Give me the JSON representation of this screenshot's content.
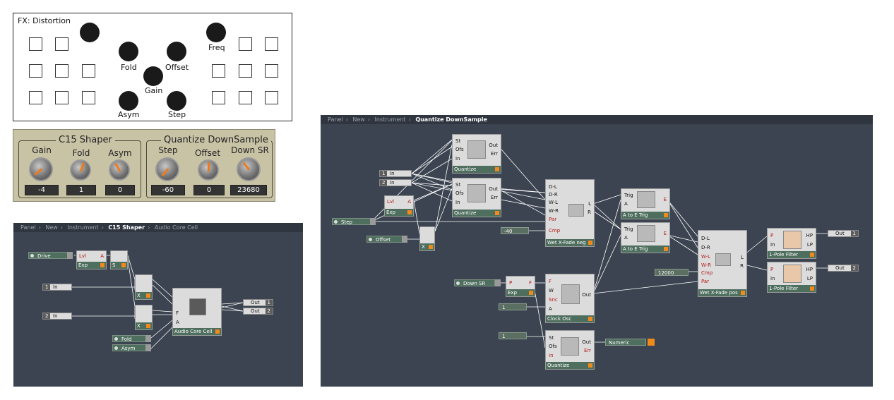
{
  "fx_panel": {
    "title": "FX: Distortion",
    "knobs": [
      "Fold",
      "Offset",
      "Gain",
      "Asym",
      "Step",
      "Freq"
    ]
  },
  "shaper_panel": {
    "group1": {
      "title": "C15 Shaper",
      "labels": [
        "Gain",
        "Fold",
        "Asym"
      ],
      "values": [
        "-4",
        "1",
        "0"
      ]
    },
    "group2": {
      "title": "Quantize DownSample",
      "labels": [
        "Step",
        "Offset",
        "Down SR"
      ],
      "values": [
        "-60",
        "0",
        "23680"
      ]
    }
  },
  "editor1": {
    "breadcrumb": [
      "Panel",
      "New",
      "Instrument",
      "C15 Shaper",
      "Audio Core Cell"
    ],
    "controls": {
      "drive": "Drive",
      "fold": "Fold",
      "asym": "Asym"
    },
    "inputs": [
      {
        "label": "In",
        "num": "1"
      },
      {
        "label": "In",
        "num": "2"
      }
    ],
    "outputs": [
      {
        "label": "Out",
        "num": "1"
      },
      {
        "label": "Out",
        "num": "2"
      }
    ],
    "modules": {
      "exp": {
        "title": "Exp",
        "pins": [
          "Lvl",
          "A"
        ]
      },
      "s": {
        "title": "S"
      },
      "x1": {
        "title": "X"
      },
      "x2": {
        "title": "X"
      },
      "core": {
        "title": "Audio Core Cell",
        "pins": [
          "F",
          "A"
        ]
      }
    }
  },
  "editor2": {
    "breadcrumb": [
      "Panel",
      "New",
      "Instrument",
      "Quantize DownSample"
    ],
    "controls": {
      "step": "Step",
      "offset": "Offset",
      "down_sr": "Down SR"
    },
    "inputs": [
      {
        "label": "In",
        "num": "1"
      },
      {
        "label": "In",
        "num": "2"
      }
    ],
    "outputs": [
      {
        "label": "Out",
        "num": "1"
      },
      {
        "label": "Out",
        "num": "2"
      }
    ],
    "constants": [
      "-40",
      "12000",
      "1",
      "1"
    ],
    "numeric": "Numeric",
    "modules": {
      "q1": {
        "title": "Quantize",
        "pins_in": [
          "St",
          "Ofs",
          "In"
        ],
        "pins_out": [
          "Out",
          "Err"
        ]
      },
      "q2": {
        "title": "Quantize",
        "pins_in": [
          "St",
          "Ofs",
          "In"
        ],
        "pins_out": [
          "Out",
          "Err"
        ]
      },
      "exp": {
        "title": "Exp",
        "pins": [
          "Lvl",
          "A"
        ]
      },
      "x": {
        "title": "X"
      },
      "xfade_neg": {
        "title": "Wet X-Fade neg",
        "pins_in": [
          "D-L",
          "D-R",
          "W-L",
          "W-R",
          "Par",
          "Cmp"
        ],
        "pins_out": [
          "L",
          "R"
        ]
      },
      "trig1": {
        "title": "A to E Trig",
        "pins_in": [
          "Trig",
          "A"
        ],
        "pins_out": [
          "E"
        ]
      },
      "trig2": {
        "title": "A to E Trig",
        "pins_in": [
          "Trig",
          "A"
        ],
        "pins_out": [
          "E"
        ]
      },
      "exp2": {
        "title": "Exp",
        "pins": [
          "P",
          "F"
        ]
      },
      "clock": {
        "title": "Clock Osc",
        "pins_in": [
          "F",
          "W",
          "Snc",
          "A"
        ],
        "pins_out": [
          "Out"
        ]
      },
      "q3": {
        "title": "Quantize",
        "pins_in": [
          "St",
          "Ofs",
          "In"
        ],
        "pins_out": [
          "Out",
          "Err"
        ]
      },
      "xfade_pos": {
        "title": "Wet X-Fade pos",
        "pins_in": [
          "D-L",
          "D-R",
          "W-L",
          "W-R",
          "Cmp",
          "Par"
        ],
        "pins_out": [
          "L",
          "R"
        ]
      },
      "lp1": {
        "title": "1-Pole Filter",
        "pins_in": [
          "P",
          "In"
        ],
        "pins_out": [
          "HP",
          "LP"
        ]
      },
      "lp2": {
        "title": "1-Pole Filter",
        "pins_in": [
          "P",
          "In"
        ],
        "pins_out": [
          "HP",
          "LP"
        ]
      }
    }
  }
}
